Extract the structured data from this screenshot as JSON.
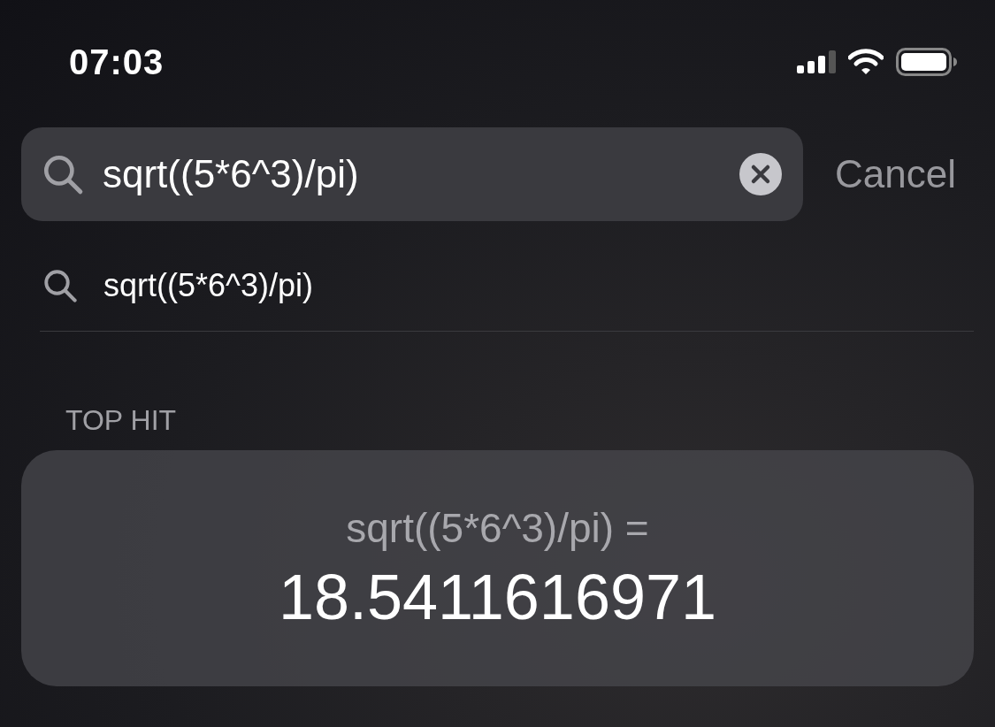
{
  "status_bar": {
    "time": "07:03"
  },
  "search": {
    "value": "sqrt((5*6^3)/pi)",
    "cancel": "Cancel"
  },
  "suggestions": [
    {
      "text": "sqrt((5*6^3)/pi)"
    }
  ],
  "top_hit": {
    "heading": "TOP HIT",
    "expression": "sqrt((5*6^3)/pi) =",
    "result": "18.5411616971"
  }
}
